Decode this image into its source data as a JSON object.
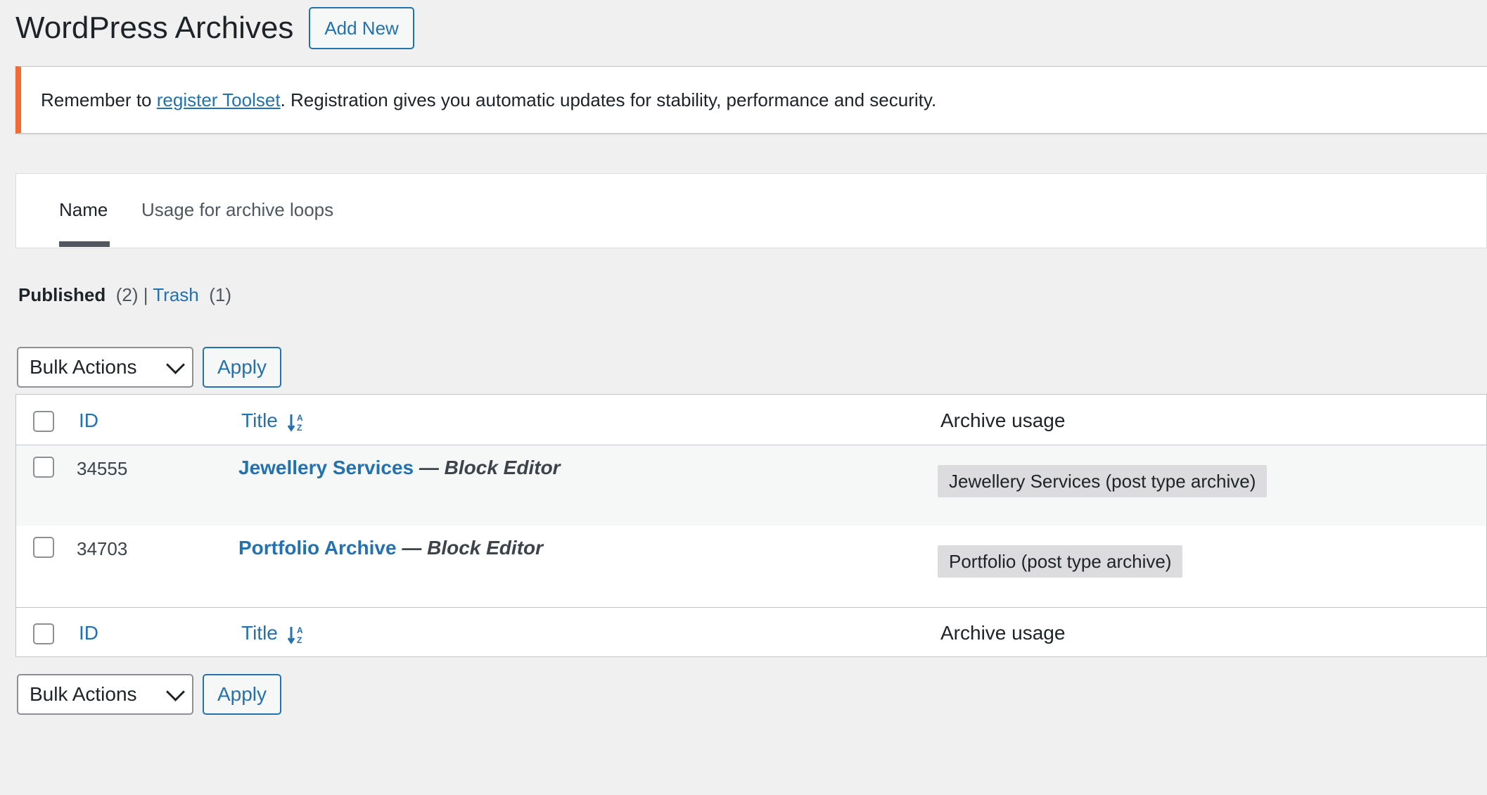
{
  "header": {
    "title": "WordPress Archives",
    "add_new_label": "Add New"
  },
  "notice": {
    "prefix": "Remember to ",
    "link_text": "register Toolset",
    "suffix": ". Registration gives you automatic updates for stability, performance and security.",
    "accent_color": "#f06c34"
  },
  "tabs": [
    {
      "label": "Name",
      "active": true
    },
    {
      "label": "Usage for archive loops",
      "active": false
    }
  ],
  "status": {
    "published_label": "Published",
    "published_count": "(2)",
    "separator": "|",
    "trash_label": "Trash",
    "trash_count": "(1)"
  },
  "bulk": {
    "select_label": "Bulk Actions",
    "apply_label": "Apply"
  },
  "table": {
    "columns": {
      "id": "ID",
      "title": "Title",
      "usage": "Archive usage"
    },
    "rows": [
      {
        "id": "34555",
        "title": "Jewellery Services",
        "state": " — Block Editor",
        "usage": "Jewellery Services (post type archive)"
      },
      {
        "id": "34703",
        "title": "Portfolio Archive",
        "state": " — Block Editor",
        "usage": "Portfolio (post type archive)"
      }
    ]
  },
  "colors": {
    "link": "#2271b1",
    "background": "#f0f0f1"
  },
  "icons": {
    "sort": "sort-alpha-icon",
    "dropdown": "chevron-down-icon"
  }
}
